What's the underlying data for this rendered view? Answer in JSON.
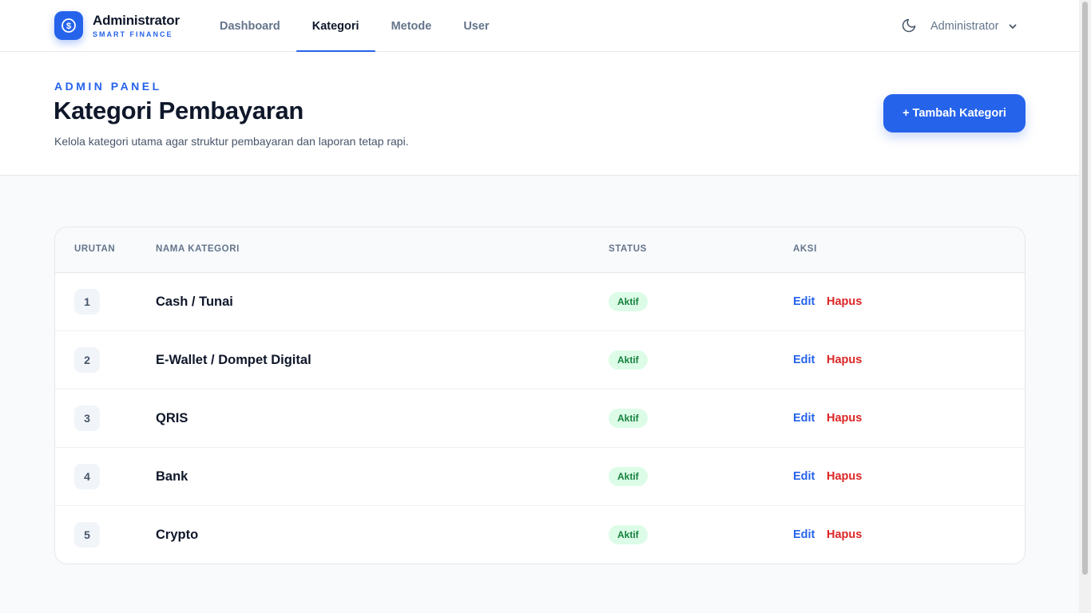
{
  "brand": {
    "title": "Administrator",
    "subtitle": "SMART FINANCE",
    "icon": "dollar-coin-icon",
    "accent_color": "#2563eb"
  },
  "nav": {
    "tabs": [
      {
        "label": "Dashboard",
        "active": false
      },
      {
        "label": "Kategori",
        "active": true
      },
      {
        "label": "Metode",
        "active": false
      },
      {
        "label": "User",
        "active": false
      }
    ]
  },
  "user_menu": {
    "name": "Administrator",
    "theme_icon": "moon-icon",
    "dropdown_icon": "chevron-down-icon"
  },
  "header": {
    "eyebrow": "ADMIN PANEL",
    "title": "Kategori Pembayaran",
    "description": "Kelola kategori utama agar struktur pembayaran dan laporan tetap rapi.",
    "add_button": "+ Tambah Kategori"
  },
  "table": {
    "columns": [
      "URUTAN",
      "NAMA KATEGORI",
      "STATUS",
      "AKSI"
    ],
    "rows": [
      {
        "order": "1",
        "name": "Cash / Tunai",
        "status": "Aktif",
        "edit": "Edit",
        "delete": "Hapus"
      },
      {
        "order": "2",
        "name": "E-Wallet / Dompet Digital",
        "status": "Aktif",
        "edit": "Edit",
        "delete": "Hapus"
      },
      {
        "order": "3",
        "name": "QRIS",
        "status": "Aktif",
        "edit": "Edit",
        "delete": "Hapus"
      },
      {
        "order": "4",
        "name": "Bank",
        "status": "Aktif",
        "edit": "Edit",
        "delete": "Hapus"
      },
      {
        "order": "5",
        "name": "Crypto",
        "status": "Aktif",
        "edit": "Edit",
        "delete": "Hapus"
      }
    ]
  },
  "colors": {
    "primary": "#2563eb",
    "status_active_bg": "#dcfce7",
    "status_active_text": "#15803d",
    "danger": "#dc2626"
  }
}
